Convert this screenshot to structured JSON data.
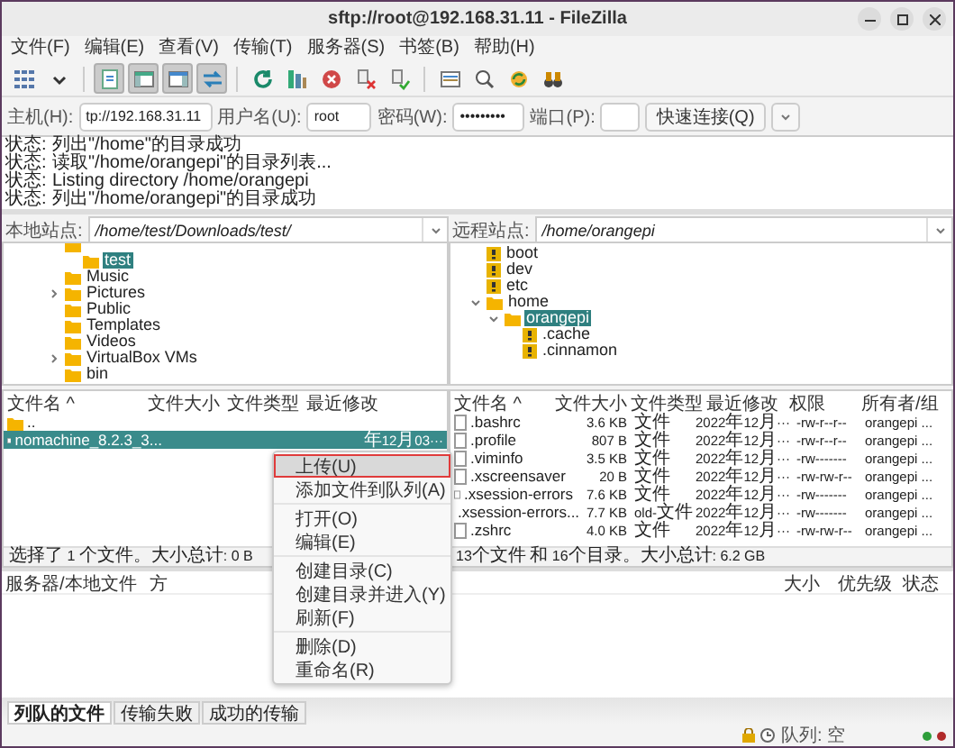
{
  "window": {
    "title": "sftp://root@192.168.31.11 - FileZilla"
  },
  "menu": [
    "文件(F)",
    "编辑(E)",
    "查看(V)",
    "传输(T)",
    "服务器(S)",
    "书签(B)",
    "帮助(H)"
  ],
  "toolbar": [
    {
      "buttons": [
        {
          "kind": "sitemanager",
          "pressed": false
        },
        {
          "kind": "dropdown",
          "pressed": false
        }
      ]
    },
    {
      "buttons": [
        {
          "kind": "log",
          "pressed": true
        },
        {
          "kind": "localtree",
          "pressed": true
        },
        {
          "kind": "remotetree",
          "pressed": true
        },
        {
          "kind": "queue",
          "pressed": true
        }
      ]
    },
    {
      "buttons": [
        {
          "kind": "refresh",
          "pressed": false
        },
        {
          "kind": "process",
          "pressed": false
        },
        {
          "kind": "cancel",
          "pressed": false
        },
        {
          "kind": "disconnect",
          "pressed": false
        },
        {
          "kind": "reconnect",
          "pressed": false
        }
      ]
    },
    {
      "buttons": [
        {
          "kind": "compare",
          "pressed": false
        },
        {
          "kind": "search",
          "pressed": false
        },
        {
          "kind": "sync",
          "pressed": false
        },
        {
          "kind": "find",
          "pressed": false
        }
      ]
    }
  ],
  "quickconnect": {
    "host_label": "主机(H):",
    "host": "tp://192.168.31.11",
    "user_label": "用户名(U):",
    "user": "root",
    "password_label": "密码(W):",
    "password": "•••••••••",
    "port_label": "端口(P):",
    "button": "快速连接(Q)"
  },
  "log": [
    {
      "label": "状态:",
      "text": "列出\"/home\"的目录成功"
    },
    {
      "label": "状态:",
      "text": "读取\"/home/orangepi\"的目录列表..."
    },
    {
      "label": "状态:",
      "text": "Listing directory /home/orangepi"
    },
    {
      "label": "状态:",
      "text": "列出\"/home/orangepi\"的目录成功"
    }
  ],
  "local": {
    "label": "本地站点:",
    "path": "/home/test/Downloads/test/",
    "tree": [
      {
        "kind": "folder",
        "children": [
          {
            "kind": "folder",
            "name": "test",
            "selected": true
          }
        ]
      },
      {
        "kind": "folder",
        "name": "Music",
        "selected": false
      },
      {
        "kind": "folder",
        "name": "Pictures",
        "selected": false,
        "expanded": false
      },
      {
        "kind": "folder",
        "name": "Public",
        "selected": false
      },
      {
        "kind": "folder",
        "name": "Templates",
        "selected": false
      },
      {
        "kind": "folder",
        "name": "Videos",
        "selected": false
      },
      {
        "kind": "folder",
        "name": "VirtualBox VMs",
        "selected": false,
        "expanded": false
      },
      {
        "kind": "folder",
        "name": "bin",
        "selected": false
      }
    ],
    "columns": [
      "文件名 ^",
      "文件大小",
      "文件类型",
      "最近修改"
    ],
    "rows": [
      {
        "kind": "folder",
        "cells": [
          ".."
        ],
        "selected": false
      },
      {
        "kind": "file",
        "cells": [
          "nomachine_8.2.3_3...",
          "",
          "",
          "年12月03···"
        ],
        "selected": true
      }
    ],
    "status": "选择了 1 个文件。大小总计: 0 B"
  },
  "remote": {
    "label": "远程站点:",
    "path": "/home/orangepi",
    "tree": [
      {
        "kind": "unknown",
        "name": "boot",
        "selected": false
      },
      {
        "kind": "unknown",
        "name": "dev",
        "selected": false
      },
      {
        "kind": "unknown",
        "name": "etc",
        "selected": false
      },
      {
        "kind": "folder",
        "name": "home",
        "selected": false,
        "expanded": true,
        "children": [
          {
            "kind": "folder",
            "name": "orangepi",
            "selected": true,
            "expanded": true,
            "children": [
              {
                "kind": "unknown",
                "name": ".cache",
                "selected": false
              },
              {
                "kind": "unknown",
                "name": ".cinnamon",
                "selected": false
              }
            ]
          }
        ]
      }
    ],
    "columns": [
      "文件名 ^",
      "文件大小",
      "文件类型",
      "最近修改",
      "权限",
      "所有者/组"
    ],
    "rows": [
      {
        "kind": "file",
        "cells": [
          ".bashrc",
          "3.6 KB",
          "文件",
          "2022年12月···",
          "-rw-r--r--",
          "orangepi ..."
        ],
        "selected": false
      },
      {
        "kind": "file",
        "cells": [
          ".profile",
          "807 B",
          "文件",
          "2022年12月···",
          "-rw-r--r--",
          "orangepi ..."
        ],
        "selected": false
      },
      {
        "kind": "file",
        "cells": [
          ".viminfo",
          "3.5 KB",
          "文件",
          "2022年12月···",
          "-rw-------",
          "orangepi ..."
        ],
        "selected": false
      },
      {
        "kind": "file",
        "cells": [
          ".xscreensaver",
          "20 B",
          "文件",
          "2022年12月···",
          "-rw-rw-r--",
          "orangepi ..."
        ],
        "selected": false
      },
      {
        "kind": "file",
        "cells": [
          ".xsession-errors",
          "7.6 KB",
          "文件",
          "2022年12月···",
          "-rw-------",
          "orangepi ..."
        ],
        "selected": false
      },
      {
        "kind": "file",
        "cells": [
          ".xsession-errors...",
          "7.7 KB",
          "old-文件",
          "2022年12月···",
          "-rw-------",
          "orangepi ..."
        ],
        "selected": false
      },
      {
        "kind": "file",
        "cells": [
          ".zshrc",
          "4.0 KB",
          "文件",
          "2022年12月···",
          "-rw-rw-r--",
          "orangepi ..."
        ],
        "selected": false
      }
    ],
    "status": "13个文件 和 16个目录。大小总计: 6.2 GB"
  },
  "queue": {
    "columns": [
      "服务器/本地文件",
      "方",
      "大小",
      "优先级",
      "状态"
    ]
  },
  "context_menu": [
    {
      "items": [
        {
          "label": "上传(U)",
          "highlighted": true
        },
        {
          "label": "添加文件到队列(A)",
          "highlighted": false
        }
      ]
    },
    {
      "items": [
        {
          "label": "打开(O)",
          "highlighted": false
        },
        {
          "label": "编辑(E)",
          "highlighted": false
        }
      ]
    },
    {
      "items": [
        {
          "label": "创建目录(C)",
          "highlighted": false
        },
        {
          "label": "创建目录并进入(Y)",
          "highlighted": false
        },
        {
          "label": "刷新(F)",
          "highlighted": false
        }
      ]
    },
    {
      "items": [
        {
          "label": "删除(D)",
          "highlighted": false
        },
        {
          "label": "重命名(R)",
          "highlighted": false
        }
      ]
    }
  ],
  "tabs": [
    {
      "label": "列队的文件",
      "selected": true
    },
    {
      "label": "传输失败",
      "selected": false
    },
    {
      "label": "成功的传输",
      "selected": false
    }
  ],
  "status_bar": {
    "queue": "队列: 空",
    "indicators": [
      {
        "color": "#2e9e3a"
      },
      {
        "color": "#b02a2a"
      }
    ]
  }
}
